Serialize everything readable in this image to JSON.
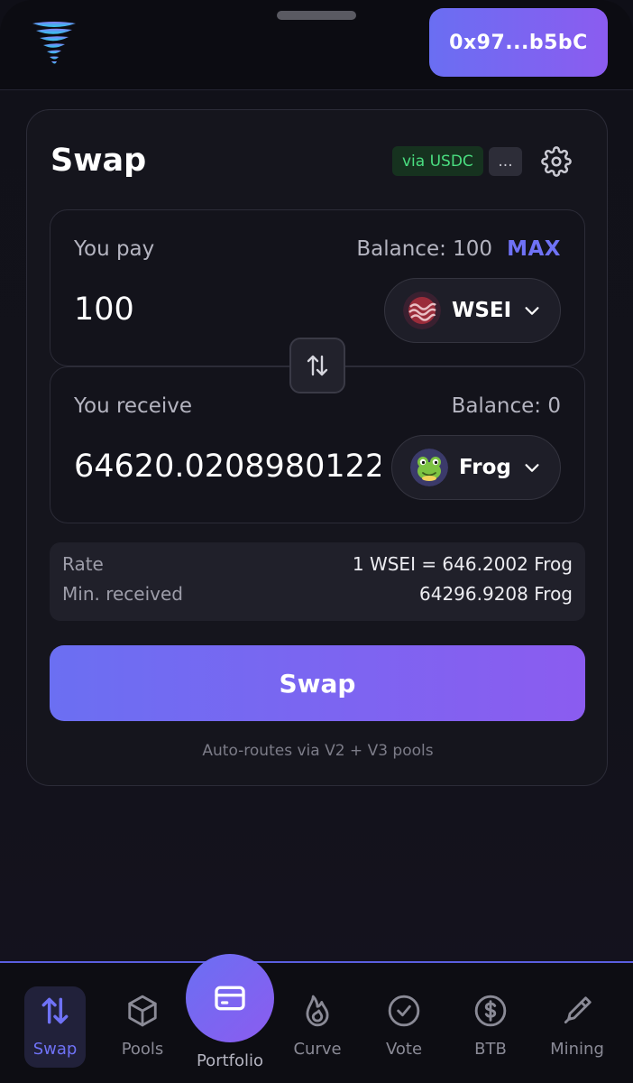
{
  "header": {
    "logo_icon": "tornado-logo-icon",
    "wallet_label": "0x97...b5bC"
  },
  "swap_card": {
    "title": "Swap",
    "route_badge": "via USDC",
    "more_badge": "...",
    "settings_icon": "gear-icon",
    "pay": {
      "label": "You pay",
      "balance": "Balance: 100",
      "max_label": "MAX",
      "amount": "100",
      "token": {
        "name": "WSEI",
        "icon": "sei-token-icon"
      }
    },
    "switch_icon": "swap-arrows-icon",
    "receive": {
      "label": "You receive",
      "balance": "Balance: 0",
      "amount": "64620.020898012244",
      "token": {
        "name": "Frog",
        "icon": "frog-token-icon"
      }
    },
    "info": {
      "rate_label": "Rate",
      "rate_value": "1 WSEI = 646.2002 Frog",
      "min_label": "Min. received",
      "min_value": "64296.9208 Frog"
    },
    "swap_button": "Swap",
    "footnote": "Auto-routes via V2 + V3 pools"
  },
  "nav": {
    "items": [
      {
        "label": "Swap",
        "icon": "swap-arrows-icon",
        "active": true
      },
      {
        "label": "Pools",
        "icon": "cube-icon"
      },
      {
        "label": "Portfolio",
        "icon": "card-icon"
      },
      {
        "label": "Curve",
        "icon": "flame-icon"
      },
      {
        "label": "Vote",
        "icon": "check-circle-icon"
      },
      {
        "label": "BTB",
        "icon": "dollar-coin-icon"
      },
      {
        "label": "Mining",
        "icon": "pickaxe-icon"
      }
    ]
  },
  "colors": {
    "accent": "#6f72f6",
    "gradient_start": "#6b6ff2",
    "gradient_end": "#8b5cf0",
    "route_badge_text": "#4ade80",
    "background": "#111119"
  }
}
